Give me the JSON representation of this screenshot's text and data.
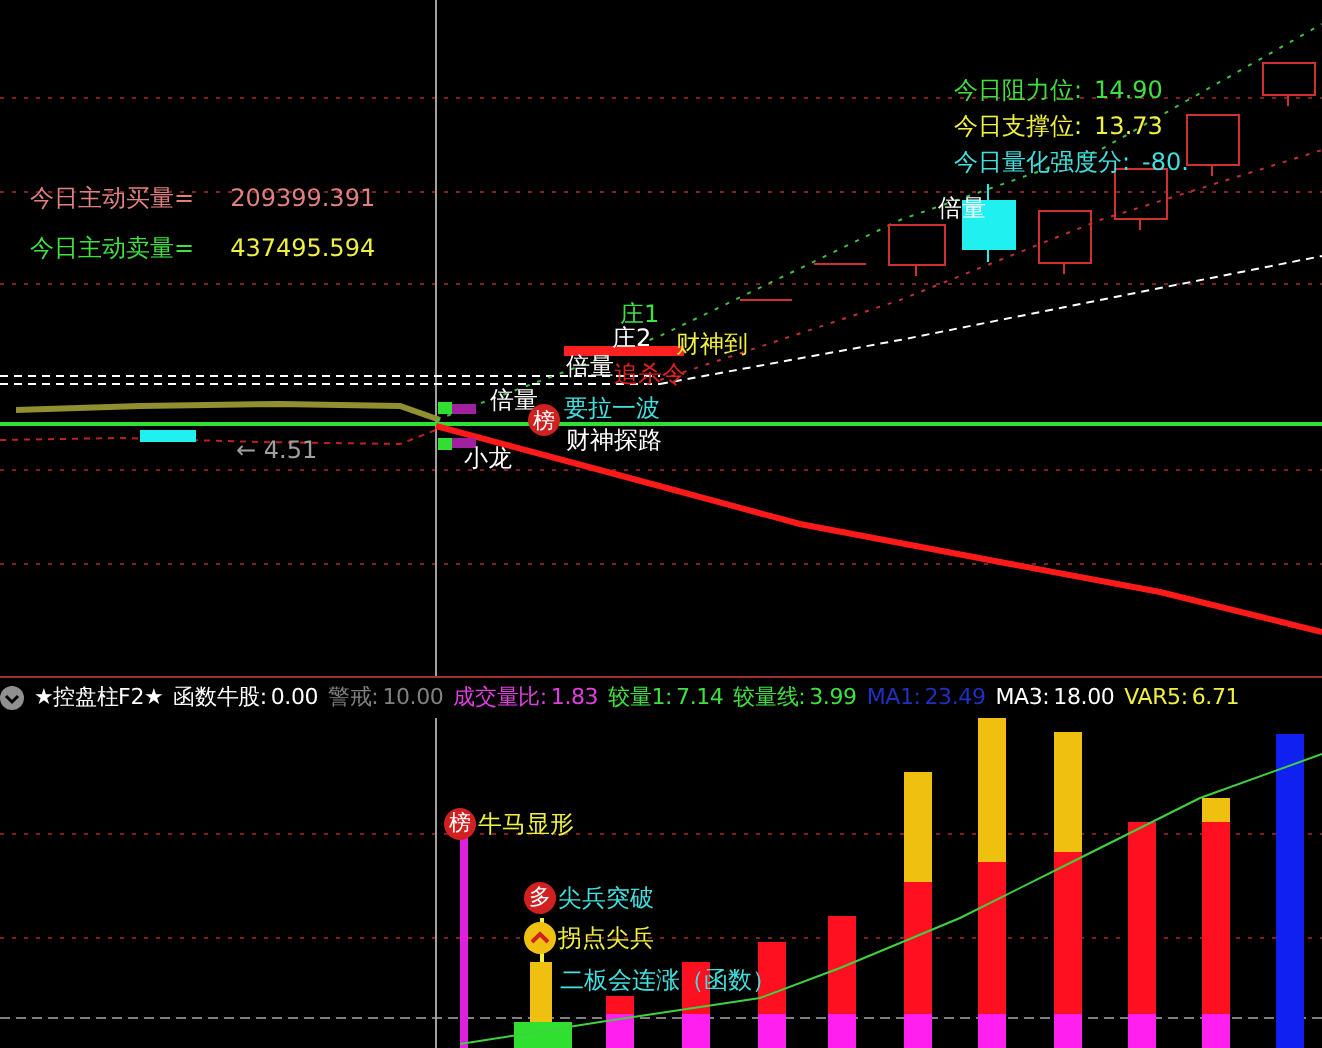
{
  "price_panel": {
    "stats": [
      {
        "label": {
          "text": "今日主动买量=",
          "color": "#e08080"
        },
        "value": {
          "text": "209399.391",
          "color": "#e08080"
        }
      },
      {
        "label": {
          "text": "今日主动卖量=",
          "color": "#40e040"
        },
        "value": {
          "text": "437495.594",
          "color": "#f0f040"
        }
      }
    ],
    "levels": [
      {
        "label": "今日阻力位:",
        "value": "14.90",
        "color": "#40e040"
      },
      {
        "label": "今日支撑位:",
        "value": "13.73",
        "color": "#f0f040"
      },
      {
        "label": "今日量化强度分:",
        "value": "-80.",
        "color": "#40e0e0"
      }
    ],
    "signals": [
      {
        "text": "倍量",
        "color": "#ffffff"
      },
      {
        "text": "庄1",
        "color": "#40e040"
      },
      {
        "text": "庄2",
        "color": "#ffffff"
      },
      {
        "text": "财神到",
        "color": "#f0f040"
      },
      {
        "text": "倍量",
        "color": "#ffffff"
      },
      {
        "text": "追杀令",
        "color": "#e02020"
      },
      {
        "text": "倍量",
        "color": "#ffffff"
      },
      {
        "text": "要拉一波",
        "color": "#40e0e0"
      },
      {
        "text": "财神探路",
        "color": "#ffffff"
      },
      {
        "text": "小龙",
        "color": "#ffffff"
      },
      {
        "text": "← 4.51",
        "color": "#a0a0a0"
      }
    ],
    "badge": "榜"
  },
  "indicator_panel": {
    "title": "★控盘柱F2★",
    "values": [
      {
        "label": "函数牛股:",
        "value": "0.00",
        "color": "#ffffff"
      },
      {
        "label": "警戒:",
        "value": "10.00",
        "color": "#808080"
      },
      {
        "label": "成交量比:",
        "value": "1.83",
        "color": "#e040e0"
      },
      {
        "label": "较量1:",
        "value": "7.14",
        "color": "#40e040"
      },
      {
        "label": "较量线:",
        "value": "3.99",
        "color": "#40e040"
      },
      {
        "label": "MA1:",
        "value": "23.49",
        "color": "#2030c0"
      },
      {
        "label": "MA3:",
        "value": "18.00",
        "color": "#ffffff"
      },
      {
        "label": "VAR5:",
        "value": "6.71",
        "color": "#f0f040"
      }
    ],
    "signals": [
      {
        "kind": "badge",
        "badge": "榜",
        "text": "牛马显形",
        "color": "#f0f040"
      },
      {
        "kind": "badge",
        "badge": "多",
        "text": "尖兵突破",
        "color": "#40e0e0"
      },
      {
        "kind": "icon",
        "text": "拐点尖兵",
        "color": "#f0f040"
      },
      {
        "kind": "plain",
        "text": "二板会连涨（函数）",
        "color": "#40e0e0"
      }
    ]
  }
}
